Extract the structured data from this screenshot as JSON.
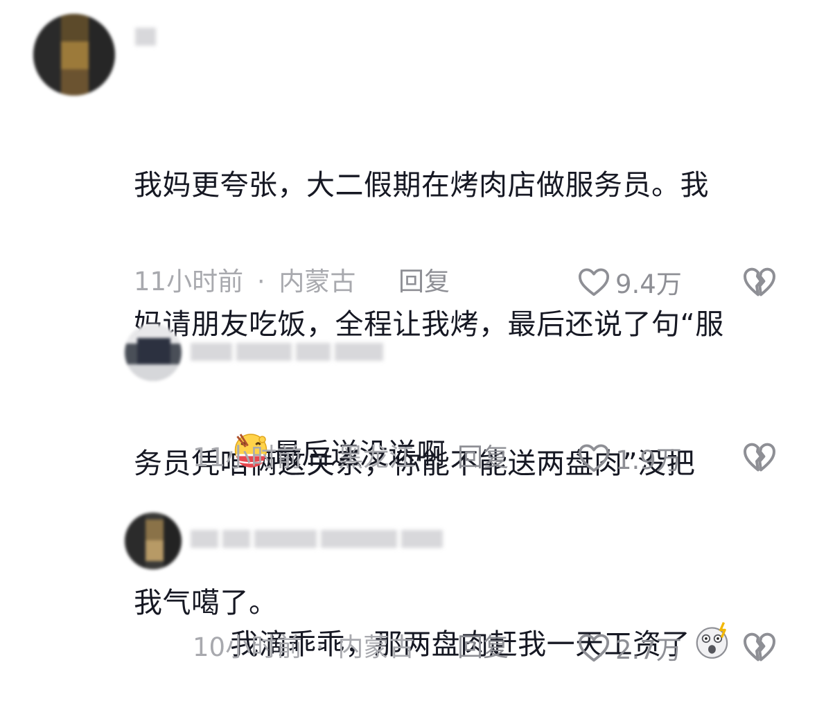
{
  "comments": [
    {
      "text": "我妈更夸张，大二假期在烤肉店做服务员。我妈请朋友吃饭，全程让我烤，最后还说了句“服务员凭咱俩这关系，你能不能送两盘肉”没把我气噶了。",
      "lines": [
        "我妈更夸张，大二假期在烤肉店做服务员。我",
        "妈请朋友吃饭，全程让我烤，最后还说了句“服",
        "务员凭咱俩这关系，你能不能送两盘肉”没把",
        "我气噶了。"
      ],
      "time": "11小时前",
      "location": "内蒙古",
      "separator": "·",
      "reply_label": "回复",
      "likes": "9.4万"
    },
    {
      "text": "最后送没送啊",
      "emoji_before": "eating-emoji",
      "time": "11小时前",
      "location": "黑龙江",
      "separator": "·",
      "reply_label": "回复",
      "likes": "1.9万"
    },
    {
      "text": "我滴乖乖，那两盘肉赶我一天工资了",
      "emoji_after": "shocked-emoji",
      "time": "10小时前",
      "location": "内蒙古",
      "separator": "·",
      "reply_label": "回复",
      "likes": "2.7万"
    }
  ],
  "colors": {
    "text": "#161823",
    "meta": "#a8a9ae",
    "action": "#8e8f95"
  },
  "icons": {
    "like": "heart-outline-icon",
    "dislike": "broken-heart-icon"
  }
}
